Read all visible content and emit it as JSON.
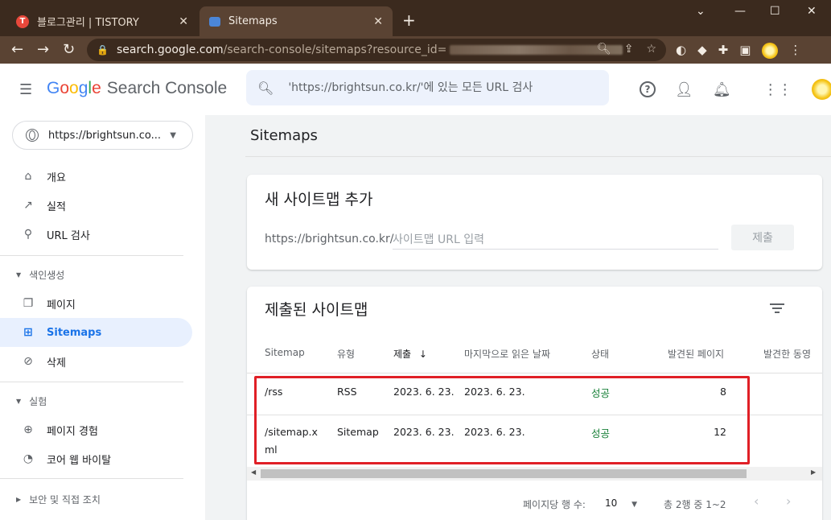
{
  "browser": {
    "tabs": [
      {
        "title": "블로그관리 | TISTORY",
        "favicon": "T"
      },
      {
        "title": "Sitemaps"
      }
    ],
    "url": {
      "host": "search.google.com",
      "path": "/search-console/sitemaps?resource_id="
    }
  },
  "header": {
    "product": "Search Console",
    "search_placeholder": "'https://brightsun.co.kr/'에 있는 모든 URL 검사"
  },
  "sidebar": {
    "property": "https://brightsun.co...",
    "items": [
      {
        "label": "개요"
      },
      {
        "label": "실적"
      },
      {
        "label": "URL 검사"
      }
    ],
    "section_indexing": "색인생성",
    "indexing_items": [
      {
        "label": "페이지"
      },
      {
        "label": "Sitemaps"
      },
      {
        "label": "삭제"
      }
    ],
    "section_experience": "실험",
    "experience_items": [
      {
        "label": "페이지 경험"
      },
      {
        "label": "코어 웹 바이탈"
      }
    ],
    "section_security": "보안 및 직접 조치"
  },
  "main": {
    "title": "Sitemaps",
    "add_card": {
      "title": "새 사이트맵 추가",
      "prefix": "https://brightsun.co.kr/",
      "input_placeholder": "사이트맵 URL 입력",
      "submit_label": "제출"
    },
    "submitted_card": {
      "title": "제출된 사이트맵",
      "columns": [
        "Sitemap",
        "유형",
        "제출",
        "마지막으로 읽은 날짜",
        "상태",
        "발견된 페이지",
        "발견한 동영"
      ],
      "sort_arrow": "↓",
      "rows": [
        {
          "sitemap": "/rss",
          "type": "RSS",
          "submitted": "2023. 6. 23.",
          "last_read": "2023. 6. 23.",
          "status": "성공",
          "pages": "8"
        },
        {
          "sitemap_line1": "/sitemap.x",
          "sitemap_line2": "ml",
          "type": "Sitemap",
          "submitted": "2023. 6. 23.",
          "last_read": "2023. 6. 23.",
          "status": "성공",
          "pages": "12"
        }
      ],
      "pagination": {
        "rows_per_page_label": "페이지당 행 수:",
        "rows_per_page": "10",
        "range": "총 2행 중 1~2"
      }
    }
  },
  "colors": {
    "accent": "#1a73e8",
    "success": "#188038",
    "highlight": "#e01f26"
  }
}
